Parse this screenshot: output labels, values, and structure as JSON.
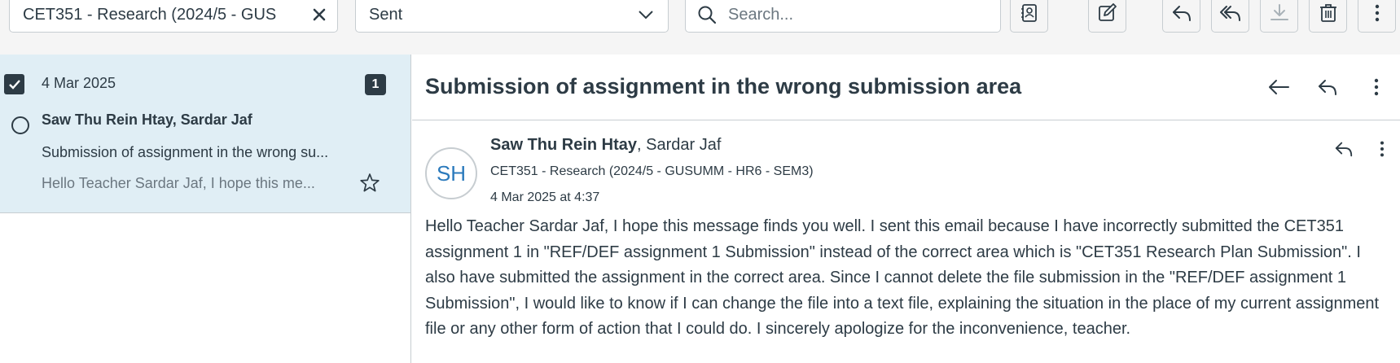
{
  "toolbar": {
    "course_filter": "CET351 - Research (2024/5 - GUS",
    "mailbox_filter": "Sent",
    "search": {
      "placeholder": "Search..."
    }
  },
  "icons": {
    "clear": "close-icon",
    "dropdown": "chevron-down-icon",
    "search": "search-icon",
    "address_book": "address-book-icon",
    "compose": "compose-icon",
    "reply": "reply-icon",
    "reply_all": "reply-all-icon",
    "archive": "download-icon",
    "delete": "trash-icon",
    "more": "more-vertical-icon",
    "back": "arrow-left-icon",
    "star": "star-icon"
  },
  "conversation_list": [
    {
      "date": "4 Mar 2025",
      "count": "1",
      "participants": "Saw Thu Rein Htay, Sardar Jaf",
      "subject": "Submission of assignment in the wrong su...",
      "preview": "Hello Teacher Sardar Jaf, I hope this me...",
      "selected": true
    }
  ],
  "message": {
    "title": "Submission of assignment in the wrong submission area",
    "avatar_initials": "SH",
    "sender_name": "Saw Thu Rein Htay",
    "other_participants": ", Sardar Jaf",
    "context": "CET351 - Research (2024/5 - GUSUMM - HR6 - SEM3)",
    "sent_at": "4 Mar 2025 at 4:37",
    "body": "Hello Teacher Sardar Jaf, I hope this message finds you well. I sent this email because I have incorrectly submitted the CET351 assignment 1 in \"REF/DEF assignment 1 Submission\" instead of the correct area which is \"CET351 Research Plan Submission\". I also have submitted the assignment in the correct area. Since I cannot delete the file submission in the \"REF/DEF assignment 1 Submission\", I would like to know if I can change the file into a text file, explaining the situation in the place of my current assignment file or any other form of action that I could do. I sincerely apologize for the inconvenience, teacher."
  },
  "colors": {
    "text": "#2d3b45",
    "muted": "#6b7780",
    "selected_row": "#e0eef5",
    "border": "#c7cdd1",
    "avatar_text": "#2b7abc",
    "toolbar_bg": "#f5f5f5"
  }
}
